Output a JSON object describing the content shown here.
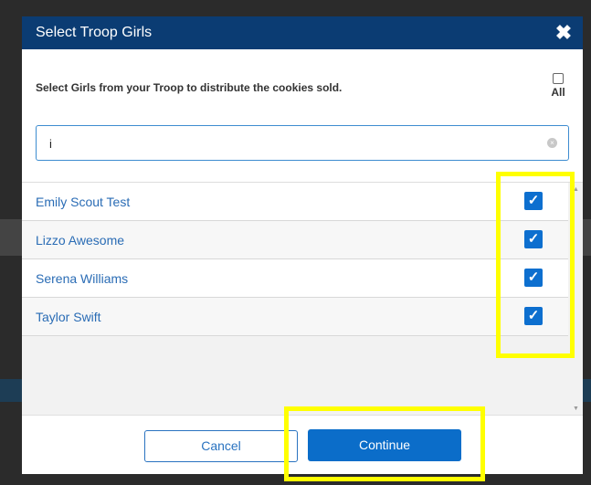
{
  "modal": {
    "title": "Select Troop Girls",
    "close_symbol": "✖",
    "instructions": "Select Girls from your Troop to distribute the cookies sold.",
    "all_label": "All",
    "all_checked": false
  },
  "search": {
    "value": "i",
    "clear_symbol": "×"
  },
  "girls": [
    {
      "name": "Emily Scout Test",
      "checked": true
    },
    {
      "name": "Lizzo Awesome",
      "checked": true
    },
    {
      "name": "Serena Williams",
      "checked": true
    },
    {
      "name": "Taylor Swift",
      "checked": true
    }
  ],
  "check_symbol": "✓",
  "footer": {
    "cancel_label": "Cancel",
    "continue_label": "Continue"
  },
  "colors": {
    "header": "#0b3c73",
    "accent": "#0b6dc9",
    "link": "#2a6cb5",
    "highlight": "#ffff00"
  }
}
